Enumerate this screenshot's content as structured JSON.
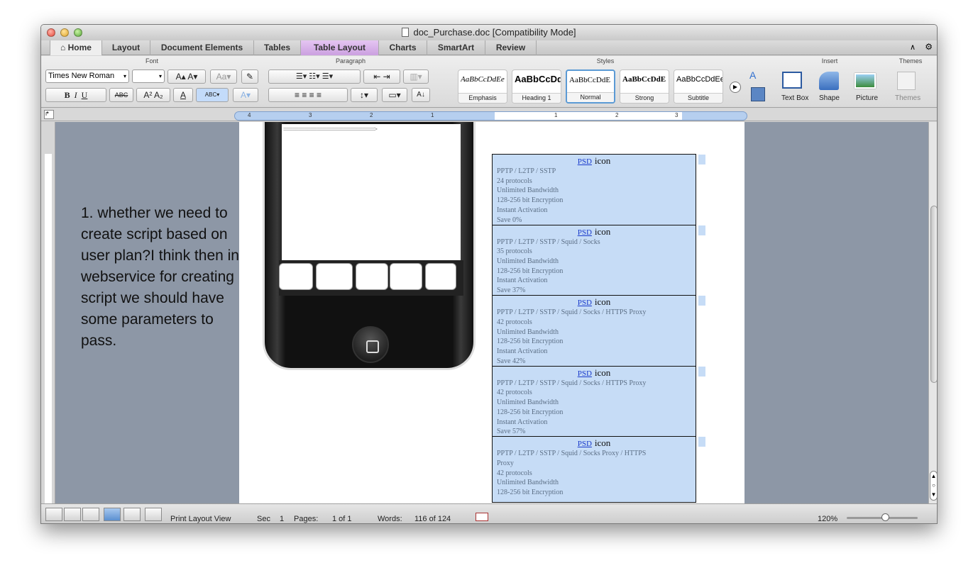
{
  "window": {
    "title": "doc_Purchase.doc [Compatibility Mode]"
  },
  "tabs": [
    {
      "label": "Home",
      "active": true
    },
    {
      "label": "Layout"
    },
    {
      "label": "Document Elements"
    },
    {
      "label": "Tables"
    },
    {
      "label": "Table Layout"
    },
    {
      "label": "Charts"
    },
    {
      "label": "SmartArt"
    },
    {
      "label": "Review"
    }
  ],
  "ribbon": {
    "groups": {
      "font": "Font",
      "paragraph": "Paragraph",
      "styles": "Styles",
      "insert": "Insert",
      "themes": "Themes"
    },
    "font_name": "Times New Roman",
    "font_size": "",
    "styles": [
      {
        "sample": "AaBbCcDdEe",
        "name": "Emphasis"
      },
      {
        "sample": "AaBbCcDd",
        "name": "Heading 1"
      },
      {
        "sample": "AaBbCcDdE",
        "name": "Normal"
      },
      {
        "sample": "AaBbCcDdE",
        "name": "Strong"
      },
      {
        "sample": "AaBbCcDdEe",
        "name": "Subtitle"
      }
    ],
    "insert": {
      "text_box": "Text Box",
      "shape": "Shape",
      "picture": "Picture"
    },
    "themes": {
      "label": "Themes"
    }
  },
  "document": {
    "comment": "1. whether we need to create script based on user plan?I think then in webservice for creating script we should have some parameters to pass.",
    "arrow_text": "==============================>",
    "plans": [
      {
        "psd": "PSD",
        "icon": "icon",
        "lines": [
          "PPTP / L2TP / SSTP",
          "24 protocols",
          "Unlimited Bandwidth",
          "128-256 bit Encryption",
          "Instant Activation",
          "Save 0%"
        ]
      },
      {
        "psd": "PSD",
        "icon": "icon",
        "lines": [
          "PPTP / L2TP / SSTP / Squid / Socks",
          "35 protocols",
          "Unlimited Bandwidth",
          "128-256 bit Encryption",
          "Instant Activation",
          "Save 37%"
        ]
      },
      {
        "psd": "PSD",
        "icon": "icon",
        "lines": [
          "PPTP / L2TP / SSTP / Squid / Socks / HTTPS Proxy",
          "42 protocols",
          "Unlimited Bandwidth",
          "128-256 bit Encryption",
          "Instant Activation",
          "Save 42%"
        ]
      },
      {
        "psd": "PSD",
        "icon": "icon",
        "lines": [
          "PPTP / L2TP / SSTP / Squid / Socks / HTTPS Proxy",
          "42 protocols",
          "Unlimited Bandwidth",
          "128-256 bit Encryption",
          "Instant Activation",
          "Save 57%"
        ]
      },
      {
        "psd": "PSD",
        "icon": "icon",
        "lines": [
          "PPTP / L2TP / SSTP / Squid / Socks Proxy / HTTPS",
          "Proxy",
          "42 protocols",
          "Unlimited Bandwidth",
          "128-256 bit Encryption"
        ]
      }
    ]
  },
  "status": {
    "view": "Print Layout View",
    "sec_label": "Sec",
    "sec_value": "1",
    "pages_label": "Pages:",
    "pages_value": "1 of 1",
    "words_label": "Words:",
    "words_value": "116 of 124",
    "zoom": "120%"
  }
}
